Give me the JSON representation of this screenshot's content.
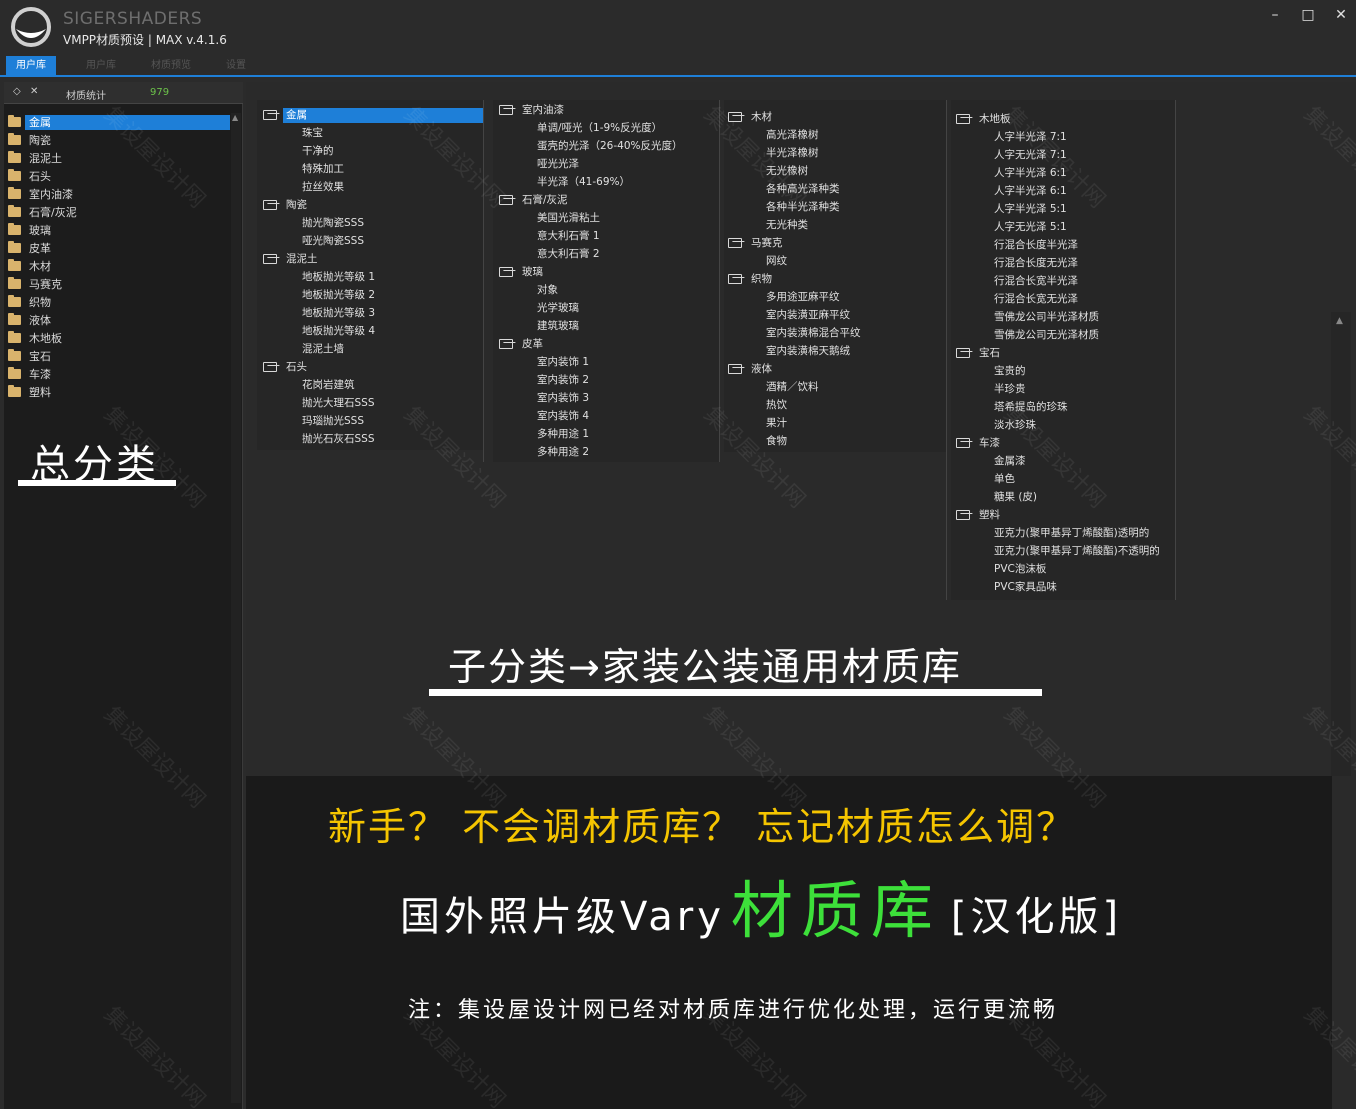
{
  "titlebar": {
    "brand": "SIGERSHADERS",
    "subtitle": "VMPP材质预设 | MAX v.4.1.6",
    "minimize_label": "–",
    "maximize_label": "□",
    "close_label": "✕"
  },
  "tabs": [
    {
      "label": "用户库",
      "active": true
    },
    {
      "label": "用户库",
      "active": false
    },
    {
      "label": "材质预览",
      "active": false
    },
    {
      "label": "设置",
      "active": false
    }
  ],
  "left_panel": {
    "header_icon_1": "◇",
    "header_icon_2": "✕",
    "stat_label": "材质统计",
    "stat_value": "979",
    "categories": [
      "金属",
      "陶瓷",
      "混泥土",
      "石头",
      "室内油漆",
      "石膏/灰泥",
      "玻璃",
      "皮革",
      "木材",
      "马赛克",
      "织物",
      "液体",
      "木地板",
      "宝石",
      "车漆",
      "塑料"
    ],
    "selected_index": 0,
    "big_label": "总分类"
  },
  "tree": {
    "col1": [
      {
        "group": "金属",
        "items": [
          "珠宝",
          "干净的",
          "特殊加工",
          "拉丝效果"
        ]
      },
      {
        "group": "陶瓷",
        "items": [
          "抛光陶瓷SSS",
          "哑光陶瓷SSS"
        ]
      },
      {
        "group": "混泥土",
        "items": [
          "地板抛光等级 1",
          "地板抛光等级 2",
          "地板抛光等级 3",
          "地板抛光等级 4",
          "混泥土墙"
        ]
      },
      {
        "group": "石头",
        "items": [
          "花岗岩建筑",
          "抛光大理石SSS",
          "玛瑙抛光SSS",
          "抛光石灰石SSS"
        ]
      }
    ],
    "col2": [
      {
        "group": "室内油漆",
        "items": [
          "单调/哑光（1-9%反光度）",
          "蛋壳的光泽（26-40%反光度）",
          "哑光光泽",
          "半光泽（41-69%）"
        ]
      },
      {
        "group": "石膏/灰泥",
        "items": [
          "美国光滑粘土",
          "意大利石膏 1",
          "意大利石膏 2"
        ]
      },
      {
        "group": "玻璃",
        "items": [
          "对象",
          "光学玻璃",
          "建筑玻璃"
        ]
      },
      {
        "group": "皮革",
        "items": [
          "室内装饰 1",
          "室内装饰 2",
          "室内装饰 3",
          "室内装饰 4",
          "多种用途 1",
          "多种用途 2"
        ]
      }
    ],
    "col3": [
      {
        "group": "木材",
        "items": [
          "高光泽橡树",
          "半光泽橡树",
          "无光橡树",
          "各种高光泽种类",
          "各种半光泽种类",
          "无光种类"
        ]
      },
      {
        "group": "马赛克",
        "items": [
          "网纹"
        ]
      },
      {
        "group": "织物",
        "items": [
          "多用途亚麻平纹",
          "室内装潢亚麻平纹",
          "室内装潢棉混合平纹",
          "室内装潢棉天鹅绒"
        ]
      },
      {
        "group": "液体",
        "items": [
          "酒精／饮料",
          "热饮",
          "果汁",
          "食物"
        ]
      }
    ],
    "col4": [
      {
        "group": "木地板",
        "items": [
          "人字半光泽 7:1",
          "人字无光泽 7:1",
          "人字半光泽 6:1",
          "人字半光泽 6:1",
          "人字半光泽 5:1",
          "人字无光泽 5:1",
          "行混合长度半光泽",
          "行混合长度无光泽",
          "行混合长宽半光泽",
          "行混合长宽无光泽",
          "雪佛龙公司半光泽材质",
          "雪佛龙公司无光泽材质"
        ]
      },
      {
        "group": "宝石",
        "items": [
          "宝贵的",
          "半珍贵",
          "塔希提岛的珍珠",
          "淡水珍珠"
        ]
      },
      {
        "group": "车漆",
        "items": [
          "金属漆",
          "单色",
          "糖果 (皮)"
        ]
      },
      {
        "group": "塑料",
        "items": [
          "亚克力(聚甲基异丁烯酸酯)透明的",
          "亚克力(聚甲基异丁烯酸酯)不透明的",
          "PVC泡沫板",
          "PVC家具品味"
        ]
      }
    ]
  },
  "annotations": {
    "subcategory_label": "子分类→家装公装通用材质库",
    "promo_line1": "新手？ 不会调材质库？  忘记材质怎么调？",
    "promo_line2_prefix": "国外照片级Vary",
    "promo_line2_highlight": "材质库",
    "promo_line2_suffix": "[汉化版]",
    "promo_note": "注：集设屋设计网已经对材质库进行优化处理，运行更流畅",
    "watermark_text": "集设屋设计网"
  },
  "colors": {
    "accent": "#1e7fd8",
    "stat_green": "#6cc24a",
    "promo_yellow": "#f5c500",
    "promo_green": "#3de03a"
  }
}
